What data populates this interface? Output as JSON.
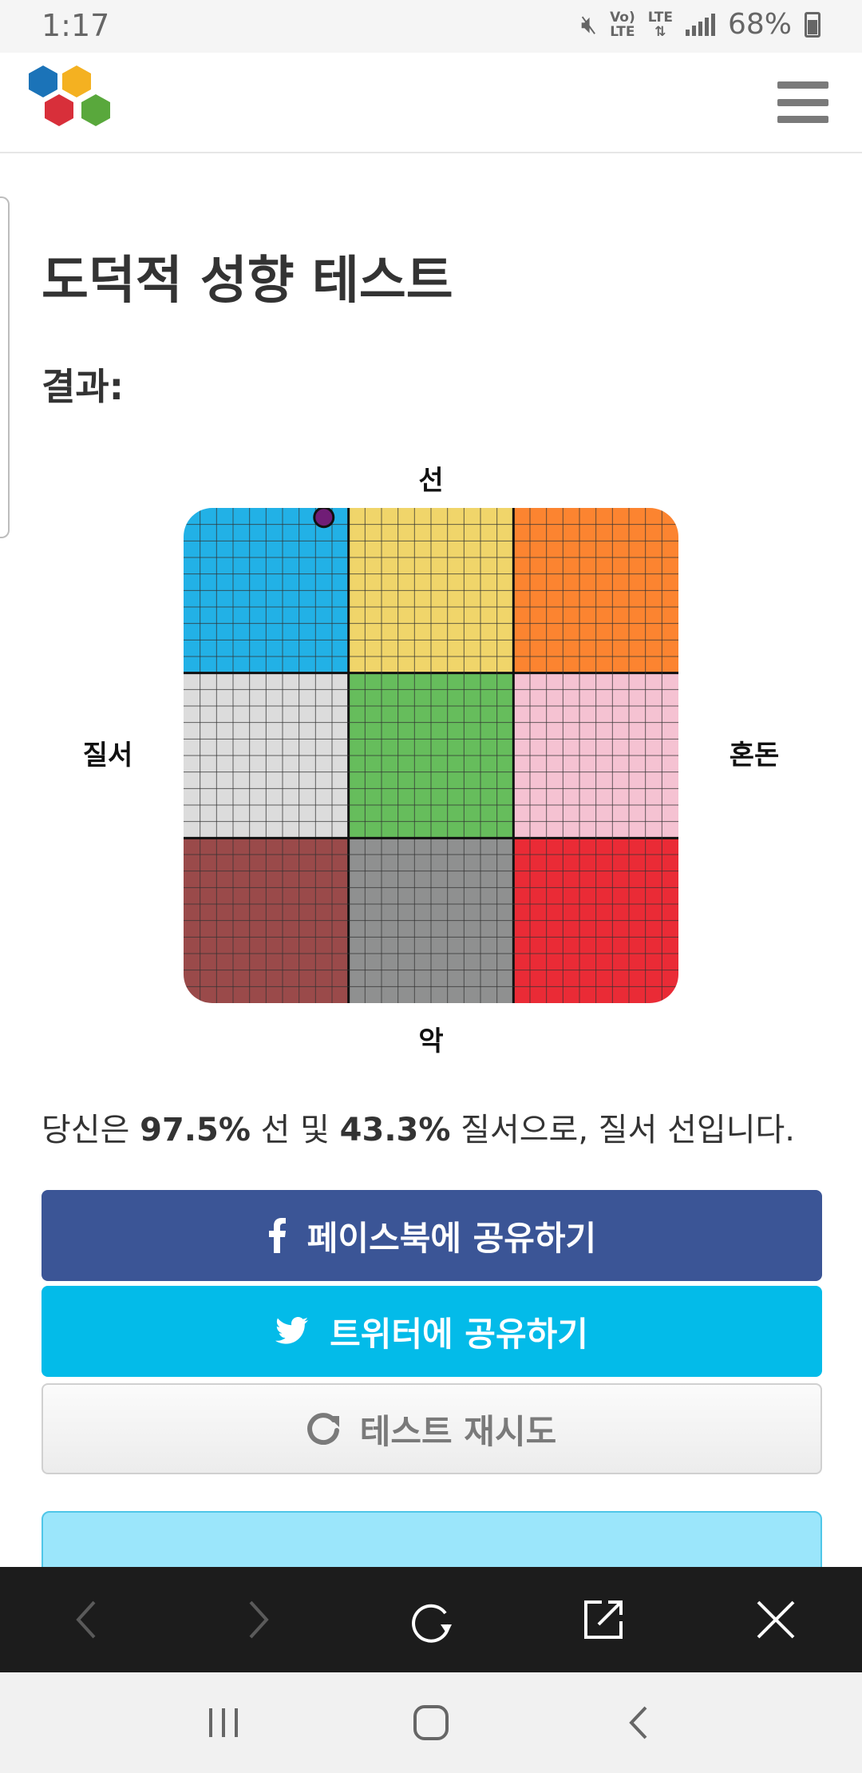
{
  "status_bar": {
    "time": "1:17",
    "volte_top": "Vo)",
    "volte_bottom": "LTE",
    "lte_label": "LTE",
    "battery_percent": "68%"
  },
  "page": {
    "title": "도덕적 성향 테스트",
    "result_label": "결과:"
  },
  "chart": {
    "axis_top": "선",
    "axis_bottom": "악",
    "axis_left": "질서",
    "axis_right": "혼돈",
    "cell_colors": [
      [
        "#22b1e6",
        "#f0d56a",
        "#fc8430"
      ],
      [
        "#dcdcdc",
        "#66bd5c",
        "#f5c2d2"
      ],
      [
        "#9a4a4a",
        "#8f9090",
        "#ea2b36"
      ]
    ],
    "marker_color": "#701d76"
  },
  "chart_data": {
    "type": "scatter",
    "title": "",
    "xlabel_left": "질서",
    "xlabel_right": "혼돈",
    "ylabel_top": "선",
    "ylabel_bottom": "악",
    "point": {
      "good_percent": 97.5,
      "lawful_percent": 43.3
    }
  },
  "result": {
    "prefix": "당신은 ",
    "good_value": "97.5%",
    "good_word": " 선 및 ",
    "lawful_value": "43.3%",
    "suffix": " 질서으로, 질서 선입니다."
  },
  "buttons": {
    "facebook_label": "페이스북에 공유하기",
    "twitter_label": "트위터에 공유하기",
    "retry_label": "테스트 재시도"
  },
  "colors": {
    "facebook": "#3b5596",
    "twitter": "#03bbe9",
    "info_box": "#9be6fb"
  }
}
